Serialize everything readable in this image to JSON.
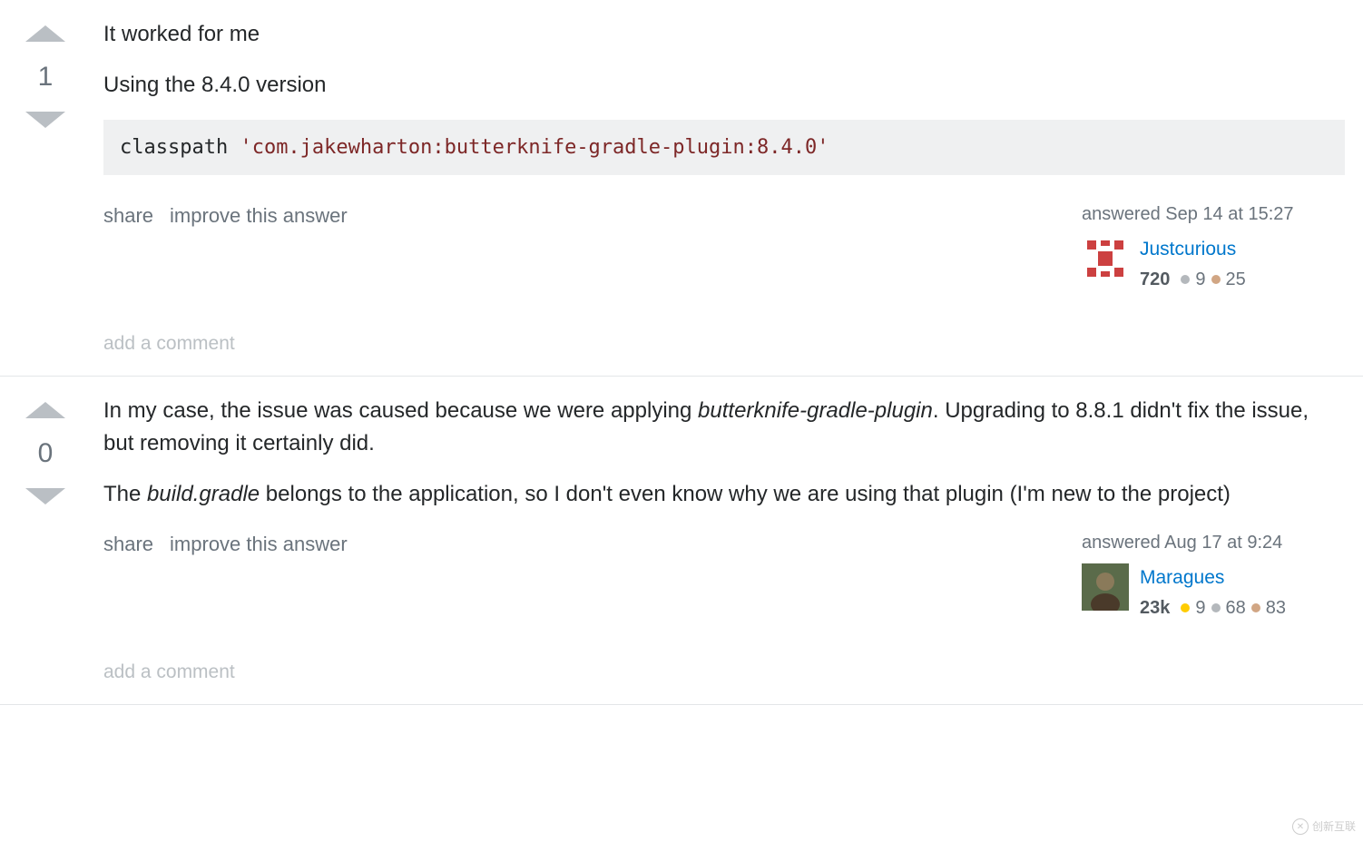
{
  "answers": [
    {
      "vote_count": "1",
      "paragraphs": [
        {
          "text": "It worked for me"
        },
        {
          "text": "Using the 8.4.0 version"
        }
      ],
      "code": {
        "keyword": "classpath ",
        "string": "'com.jakewharton:butterknife-gradle-plugin:8.4.0'"
      },
      "actions": {
        "share": "share",
        "improve": "improve this answer"
      },
      "answered_label": "answered Sep 14 at 15:27",
      "user": {
        "name": "Justcurious",
        "rep": "720",
        "silver": "9",
        "bronze": "25"
      },
      "add_comment": "add a comment"
    },
    {
      "vote_count": "0",
      "paragraphs_html": [
        "In my case, the issue was caused because we were applying <em>butterknife-gradle-plugin</em>. Upgrading to 8.8.1 didn't fix the issue, but removing it certainly did.",
        "The <em>build.gradle</em> belongs to the application, so I don't even know why we are using that plugin (I'm new to the project)"
      ],
      "actions": {
        "share": "share",
        "improve": "improve this answer"
      },
      "answered_label": "answered Aug 17 at 9:24",
      "user": {
        "name": "Maragues",
        "rep": "23k",
        "gold": "9",
        "silver": "68",
        "bronze": "83"
      },
      "add_comment": "add a comment"
    }
  ],
  "watermark": "创新互联"
}
